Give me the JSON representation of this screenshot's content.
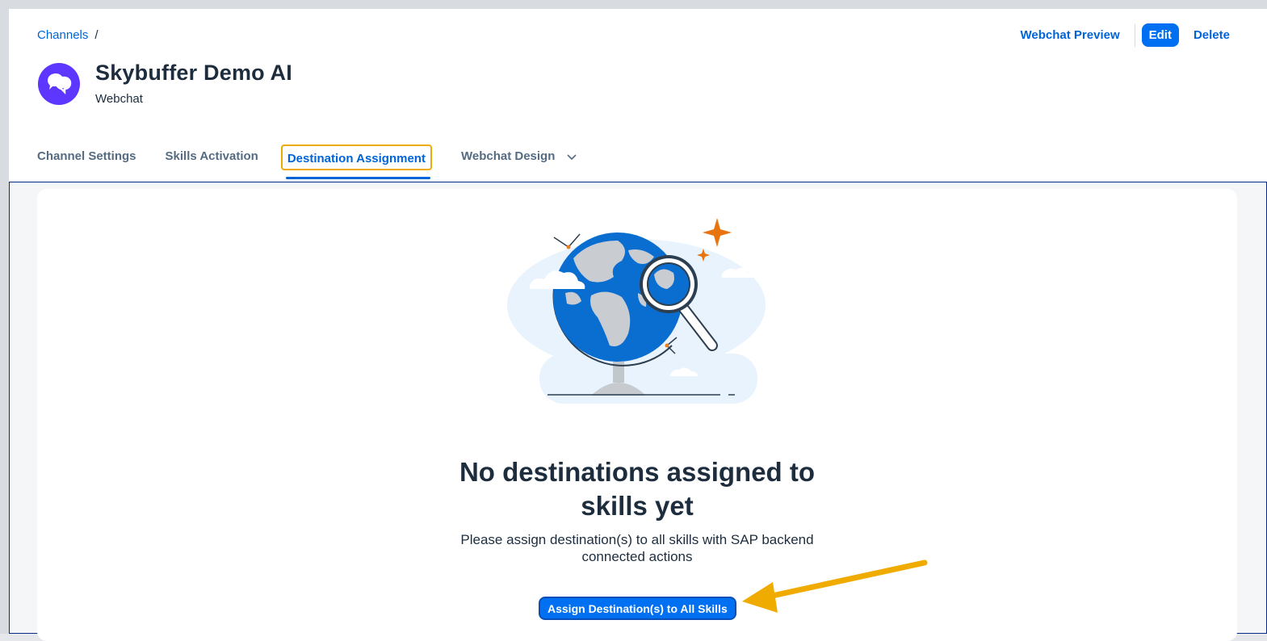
{
  "breadcrumb": {
    "channels_link": "Channels",
    "separator": "/"
  },
  "header": {
    "title": "Skybuffer Demo AI",
    "subtitle": "Webchat",
    "actions": {
      "preview": "Webchat Preview",
      "edit": "Edit",
      "delete": "Delete"
    }
  },
  "tabs": [
    {
      "label": "Channel Settings"
    },
    {
      "label": "Skills Activation"
    },
    {
      "label": "Destination Assignment",
      "active": true
    },
    {
      "label": "Webchat Design"
    }
  ],
  "empty_state": {
    "title": "No destinations assigned to skills yet",
    "description": "Please assign destination(s) to all skills with SAP backend connected actions",
    "button": "Assign Destination(s) to All Skills"
  },
  "colors": {
    "accent": "#0070f2",
    "link": "#0064d9",
    "avatar": "#5d36ff",
    "highlight": "#f0ab00"
  },
  "icons": {
    "avatar": "chat-bubbles-icon",
    "tab_overflow": "chevron-down-icon",
    "illustration": "globe-magnifier-illustration",
    "annotation": "arrow-annotation"
  }
}
